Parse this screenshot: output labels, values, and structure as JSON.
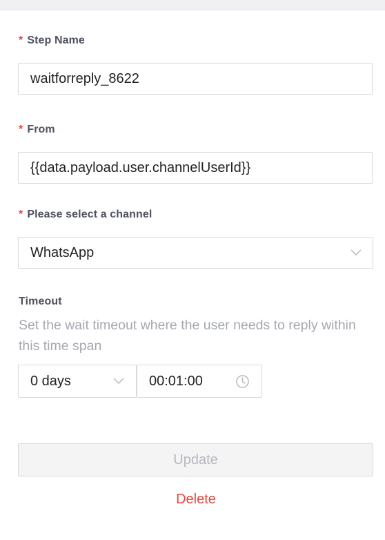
{
  "form": {
    "step_name": {
      "required_mark": "*",
      "label": "Step Name",
      "value": "waitforreply_8622"
    },
    "from": {
      "required_mark": "*",
      "label": "From",
      "value": "{{data.payload.user.channelUserId}}"
    },
    "channel": {
      "required_mark": "*",
      "label": "Please select a channel",
      "selected": "WhatsApp"
    },
    "timeout": {
      "label": "Timeout",
      "help": "Set the wait timeout where the user needs to reply within this time span",
      "days_selected": "0 days",
      "time_value": "00:01:00"
    },
    "actions": {
      "update_label": "Update",
      "delete_label": "Delete"
    }
  },
  "colors": {
    "required": "#e5463d",
    "delete": "#e5463d",
    "label": "#4e5160",
    "help_text": "#a5a8b2",
    "border": "#d9d9dc",
    "disabled_bg": "#f4f4f5"
  },
  "icons": {
    "select_channel": "chevron-down-icon",
    "select_days": "chevron-down-icon",
    "time": "clock-icon"
  }
}
